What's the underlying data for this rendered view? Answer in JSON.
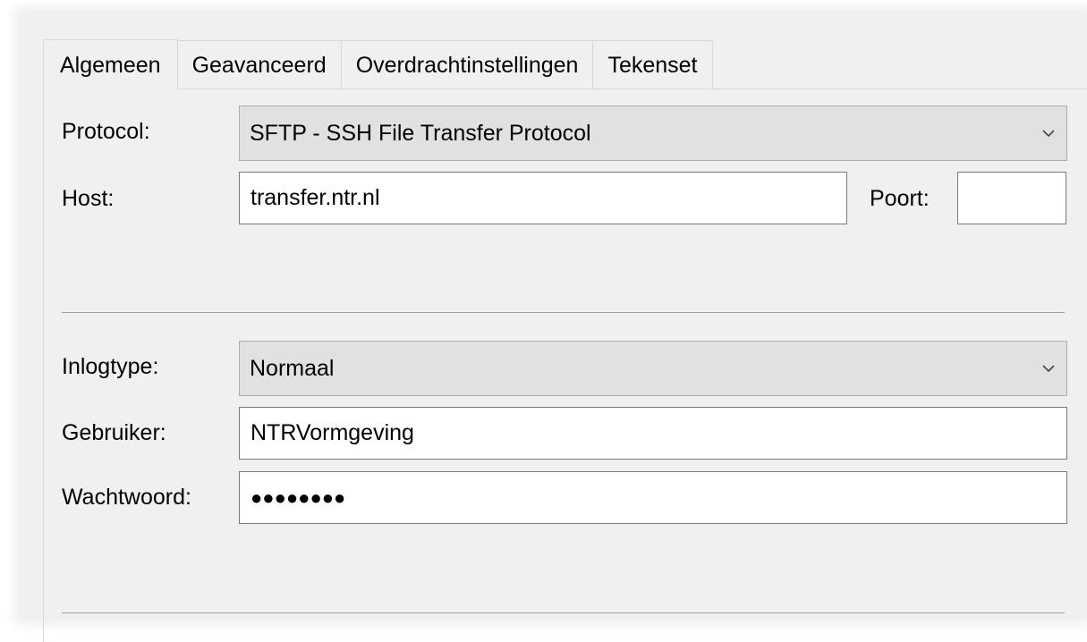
{
  "tabs": [
    {
      "label": "Algemeen",
      "active": true
    },
    {
      "label": "Geavanceerd",
      "active": false
    },
    {
      "label": "Overdrachtinstellingen",
      "active": false
    },
    {
      "label": "Tekenset",
      "active": false
    }
  ],
  "general": {
    "protocol_label": "Protocol:",
    "protocol_value": "SFTP - SSH File Transfer Protocol",
    "host_label": "Host:",
    "host_value": "transfer.ntr.nl",
    "port_label": "Poort:",
    "port_value": ""
  },
  "login": {
    "logintype_label": "Inlogtype:",
    "logintype_value": "Normaal",
    "user_label": "Gebruiker:",
    "user_value": "NTRVormgeving",
    "password_label": "Wachtwoord:",
    "password_value": "●●●●●●●●"
  },
  "icons": {
    "dropdown": "chevron-down-icon"
  },
  "colors": {
    "window_bg": "#f0f0f0",
    "combo_bg": "#e1e1e1",
    "input_border": "#7a7a7a"
  }
}
